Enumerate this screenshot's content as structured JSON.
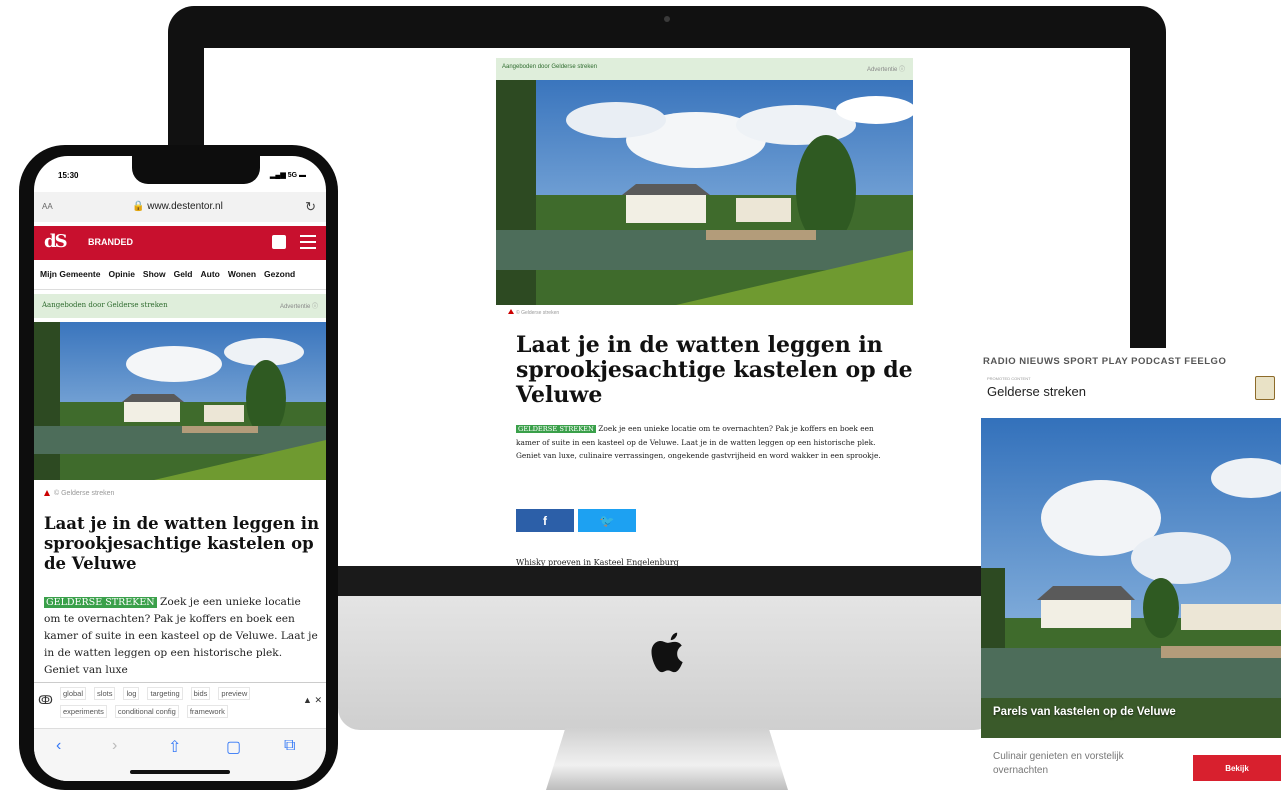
{
  "desktop": {
    "sponsor_label": "Aangeboden door Gelderse streken",
    "advert_label": "Advertentie",
    "photo_credit": "© Gelderse streken",
    "title": "Laat je in de watten leggen in sprookjesachtige kastelen op de Veluwe",
    "tag": "GELDERSE STREKEN",
    "intro": "Zoek je een unieke locatie om te overnachten? Pak je koffers en boek een kamer of suite in een kasteel op de Veluwe. Laat je in de watten leggen op een historische plek. Geniet van luxe, culinaire verrassingen, ongekende gastvrijheid en word wakker in een sprookje.",
    "share_facebook": "f",
    "share_twitter": "🐦",
    "subhead": "Whisky proeven in Kasteel Engelenburg"
  },
  "phone": {
    "time": "15:30",
    "status_right": "5G",
    "text_size": "AA",
    "url": "🔒 www.destentor.nl",
    "reload_icon": "↻",
    "logo": "dS",
    "section": "BRANDED",
    "nav": [
      "Mijn Gemeente",
      "Opinie",
      "Show",
      "Geld",
      "Auto",
      "Wonen",
      "Gezond"
    ],
    "sponsor_label": "Aangeboden door Gelderse streken",
    "advert_label": "Advertentie",
    "photo_credit": "© Gelderse streken",
    "title": "Laat je in de watten leggen in sprookjesachtige kastelen op de Veluwe",
    "tag": "GELDERSE STREKEN",
    "intro": "Zoek je een unieke locatie om te overnachten? Pak je koffers en boek een kamer of suite in een kasteel op de Veluwe. Laat je in de watten leggen op een historische plek. Geniet van luxe",
    "debug_row1": [
      "global",
      "slots",
      "log",
      "targeting",
      "bids",
      "preview"
    ],
    "debug_row2": [
      "experiments",
      "conditional config",
      "framework"
    ],
    "debug_controls": "▲ ✕",
    "toolbar": [
      "‹",
      "›",
      "⇧",
      "▢",
      "⧉"
    ]
  },
  "card": {
    "nav": "RADIO  NIEUWS  SPORT  PLAY  PODCAST  FEELGO",
    "mini_label": "PROMOTED CONTENT",
    "brand": "Gelderse streken",
    "caption": "Parels van kastelen op de Veluwe",
    "footer_text": "Culinair genieten en vorstelijk overnachten",
    "button": "Bekijk"
  }
}
